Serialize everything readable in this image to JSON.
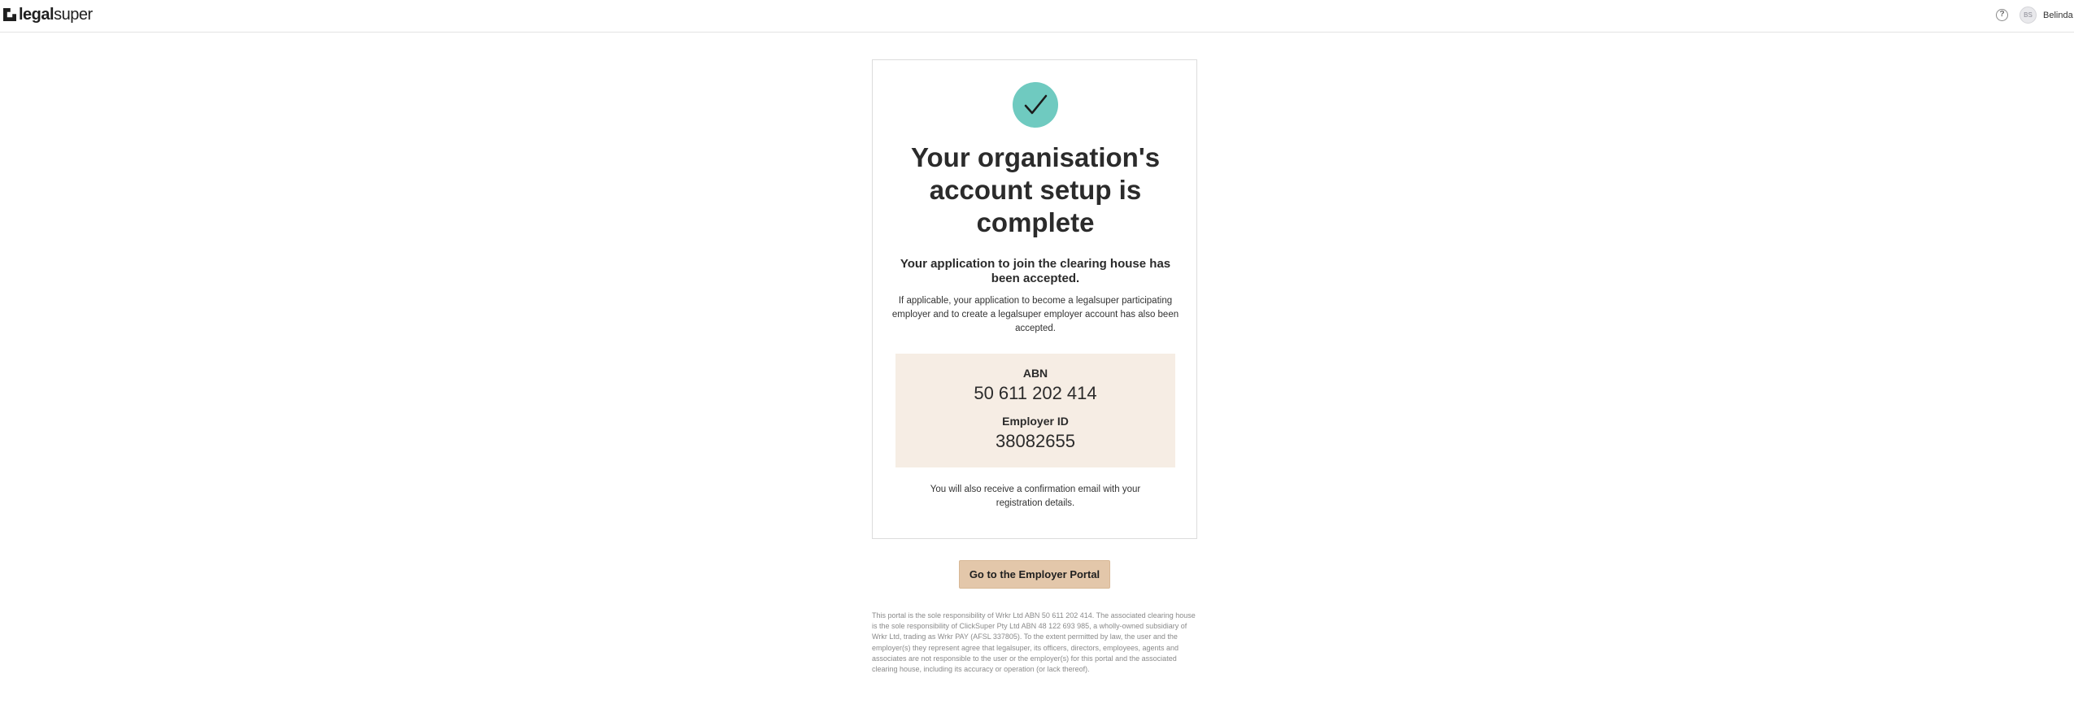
{
  "header": {
    "logo_bold": "legal",
    "logo_light": "super",
    "help_icon": "?",
    "user": {
      "initials": "BS",
      "name": "Belinda"
    }
  },
  "card": {
    "title": "Your organisation's account setup is complete",
    "subtitle": "Your application to join the clearing house has been accepted.",
    "description": "If applicable, your application to become a legalsuper participating employer and to create a legalsuper employer account has also been accepted.",
    "abn_label": "ABN",
    "abn_value": "50 611 202 414",
    "employer_id_label": "Employer ID",
    "employer_id_value": "38082655",
    "confirmation": "You will also receive a confirmation email with your registration details."
  },
  "portal_button": "Go to the Employer Portal",
  "legal_text": "This portal is the sole responsibility of Wrkr Ltd ABN 50 611 202 414. The associated clearing house is the sole responsibility of ClickSuper Pty Ltd ABN 48 122 693 985, a wholly-owned subsidiary of Wrkr Ltd, trading as Wrkr PAY (AFSL 337805). To the extent permitted by law, the user and the employer(s) they represent agree that legalsuper, its officers, directors, employees, agents and associates are not responsible to the user or the employer(s) for this portal and the associated clearing house, including its accuracy or operation (or lack thereof).",
  "colors": {
    "accent_teal": "#6fcac0",
    "id_box_bg": "#f6ede4",
    "button_bg": "#e3c7aa"
  }
}
